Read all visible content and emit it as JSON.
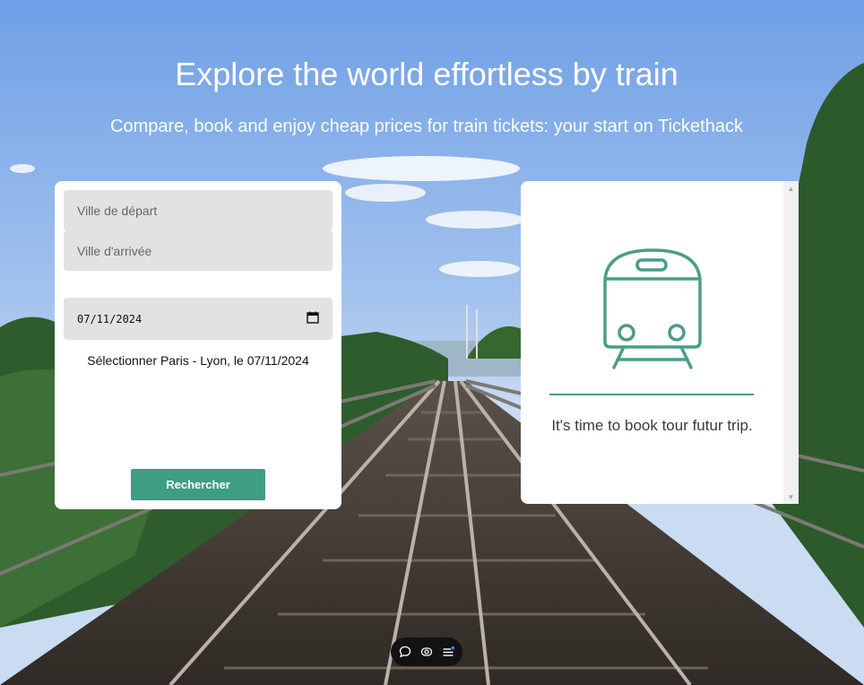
{
  "hero": {
    "title": "Explore the world effortless by train",
    "subtitle": "Compare, book and enjoy cheap prices for train tickets: your start on Tickethack"
  },
  "search": {
    "departure_placeholder": "Ville de départ",
    "arrival_placeholder": "Ville d'arrivée",
    "date_value": "07/11/2024",
    "selection_text": "Sélectionner Paris - Lyon, le 07/11/2024",
    "button_label": "Rechercher"
  },
  "results": {
    "message": "It's time to book tour futur trip.",
    "icon": "train-icon"
  },
  "toolbar": {
    "icons": [
      "chat-bubble-icon",
      "eye-icon",
      "menu-list-icon"
    ]
  },
  "colors": {
    "accent": "#3f9d84",
    "train_icon": "#4a9e84",
    "field_bg": "#e2e2e2",
    "card_bg": "#ffffff"
  }
}
